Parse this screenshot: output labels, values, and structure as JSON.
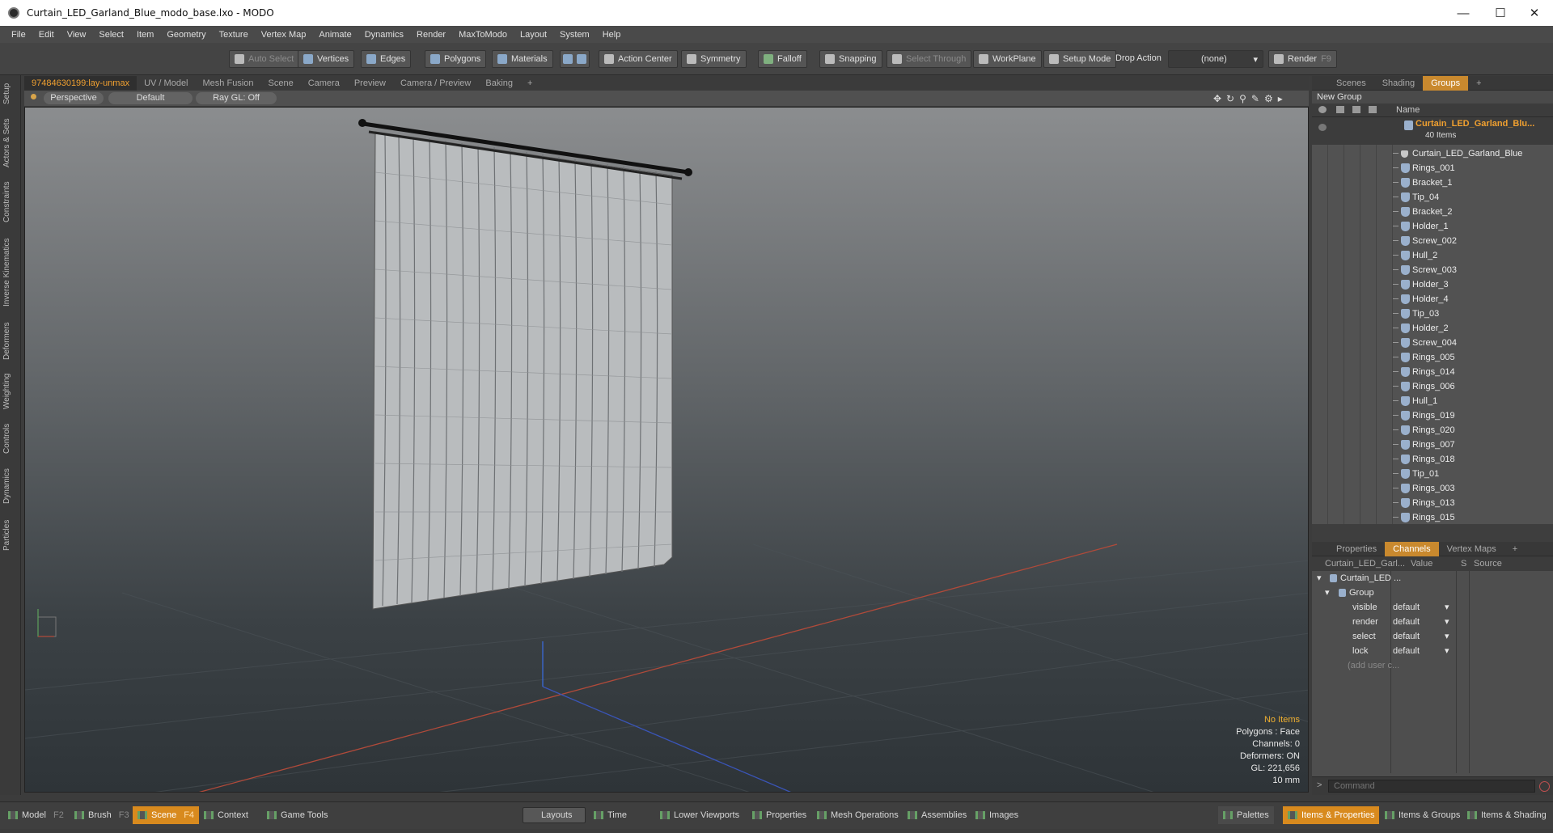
{
  "window": {
    "title": "Curtain_LED_Garland_Blue_modo_base.lxo - MODO",
    "minimize": "—",
    "maximize": "☐",
    "close": "✕"
  },
  "menu": [
    "File",
    "Edit",
    "View",
    "Select",
    "Item",
    "Geometry",
    "Texture",
    "Vertex Map",
    "Animate",
    "Dynamics",
    "Render",
    "MaxToModo",
    "Layout",
    "System",
    "Help"
  ],
  "toolbar": {
    "auto_select": "Auto Select",
    "vertices": "Vertices",
    "edges": "Edges",
    "polygons": "Polygons",
    "materials": "Materials",
    "action_center": "Action Center",
    "symmetry": "Symmetry",
    "falloff": "Falloff",
    "snapping": "Snapping",
    "select_through": "Select Through",
    "workplane": "WorkPlane",
    "setup_mode": "Setup Mode",
    "drop_action": "Drop Action",
    "drop_value": "(none)",
    "render": "Render",
    "render_key": "F9"
  },
  "left_tabs": [
    "Setup",
    "Actors & Sets",
    "Constraints",
    "Inverse Kinematics",
    "Deformers",
    "Weighting",
    "Controls",
    "Dynamics",
    "Particles"
  ],
  "viewport_tabs": [
    "97484630199:lay-unmax",
    "UV / Model",
    "Mesh Fusion",
    "Scene",
    "Camera",
    "Preview",
    "Camera / Preview",
    "Baking",
    "+"
  ],
  "viewport_header": {
    "view": "Perspective",
    "shading": "Default",
    "raygl": "Ray GL: Off"
  },
  "viewport_info": {
    "items": "No Items",
    "polygons": "Polygons : Face",
    "channels": "Channels: 0",
    "deformers": "Deformers: ON",
    "gl": "GL: 221,656",
    "scale": "10 mm"
  },
  "scene_tabs": [
    "Scenes",
    "Shading",
    "Groups",
    "+"
  ],
  "groups": {
    "new_group": "New Group",
    "name_col": "Name",
    "root": "Curtain_LED_Garland_Blu...",
    "root_count": "40 Items",
    "items": [
      "Curtain_LED_Garland_Blue",
      "Rings_001",
      "Bracket_1",
      "Tip_04",
      "Bracket_2",
      "Holder_1",
      "Screw_002",
      "Hull_2",
      "Screw_003",
      "Holder_3",
      "Holder_4",
      "Tip_03",
      "Holder_2",
      "Screw_004",
      "Rings_005",
      "Rings_014",
      "Rings_006",
      "Hull_1",
      "Rings_019",
      "Rings_020",
      "Rings_007",
      "Rings_018",
      "Tip_01",
      "Rings_003",
      "Rings_013",
      "Rings_015"
    ]
  },
  "prop_tabs": [
    "Properties",
    "Channels",
    "Vertex Maps",
    "+"
  ],
  "channels": {
    "col_item": "Curtain_LED_Garl...",
    "col_value": "Value",
    "col_s": "S",
    "col_source": "Source",
    "item": "Curtain_LED ...",
    "group": "Group",
    "rows": [
      {
        "name": "visible",
        "value": "default"
      },
      {
        "name": "render",
        "value": "default"
      },
      {
        "name": "select",
        "value": "default"
      },
      {
        "name": "lock",
        "value": "default"
      }
    ],
    "add": "(add user c..."
  },
  "command": {
    "prompt": ">",
    "placeholder": "Command"
  },
  "bottom": {
    "model": "Model",
    "model_key": "F2",
    "brush": "Brush",
    "brush_key": "F3",
    "scene": "Scene",
    "scene_key": "F4",
    "context": "Context",
    "game_tools": "Game Tools",
    "layouts": "Layouts",
    "time": "Time",
    "lower_viewports": "Lower Viewports",
    "properties": "Properties",
    "mesh_operations": "Mesh Operations",
    "assemblies": "Assemblies",
    "images": "Images",
    "palettes": "Palettes",
    "items_properties": "Items & Properties",
    "items_groups": "Items & Groups",
    "items_shading": "Items & Shading"
  },
  "colors": {
    "accent": "#d88a1e",
    "selected_group": "#f0a030"
  }
}
